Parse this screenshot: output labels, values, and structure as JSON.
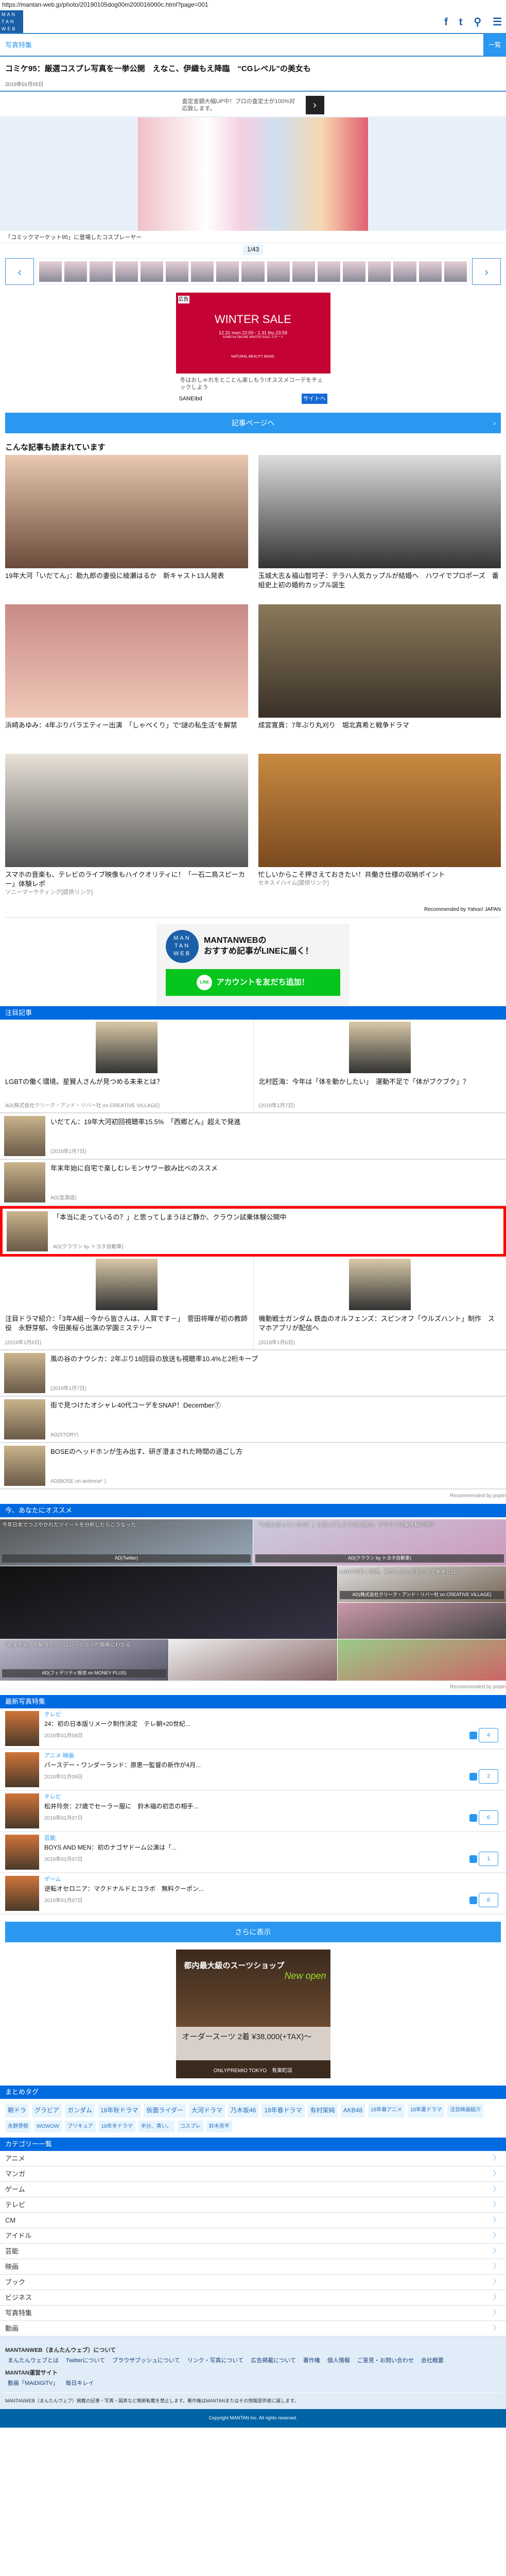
{
  "url": "https://mantan-web.jp/photo/20190105dog00m200016000c.html?page=001",
  "header": {
    "logo": "MAN TAN WEB",
    "icons": [
      "facebook-icon",
      "twitter-icon",
      "search-icon",
      "menu-icon"
    ],
    "icon_glyphs": [
      "f",
      "t",
      "⚲",
      "☰"
    ]
  },
  "section_bar": {
    "label": "写真特集",
    "button": "一覧"
  },
  "article": {
    "title": "コミケ95：厳選コスプレ写真を一挙公開　えなこ、伊織もえ降臨　“CGレベル”の美女も",
    "date": "2019年01月05日"
  },
  "top_ad": {
    "text": "査定金額大幅UP中！プロの査定士が100%対応致します。",
    "arrow": "›"
  },
  "gallery": {
    "caption": "「コミックマーケット95」に登場したコスプレーヤー",
    "counter": "1/43",
    "thumb_count": 17,
    "prev": "‹",
    "next": "›"
  },
  "ad1": {
    "badge": "広告",
    "headline": "WINTER SALE",
    "sub": "12.31 mon 22:00 - 1.31 thu 23:59",
    "sub2": "SANEI bd ONLINE WINTER SALE スタート",
    "brand": "NATURAL BEAUTY BASIC",
    "desc": "冬はおしゃれをとことん楽しもう!オススメコーデをチェックしよう",
    "advertiser": "SANEIbd",
    "cta": "サイトへ"
  },
  "article_button": {
    "label": "記事ページへ",
    "chevron": "›"
  },
  "popular": {
    "heading": "こんな記事も読まれています",
    "items": [
      {
        "title": "19年大河「いだてん」：勘九郎の妻役に綾瀬はるか　新キャスト13人発表",
        "source": ""
      },
      {
        "title": "玉城大志＆福山智可子：テラハ人気カップルが結婚へ　ハワイでプロポーズ　番組史上初の婚約カップル誕生",
        "source": ""
      },
      {
        "title": "浜崎あゆみ：4年ぶりバラエティー出演　「しゃべくり」で“謎の私生活”を解禁",
        "source": ""
      },
      {
        "title": "成宮寛貴：7年ぶり丸刈り　堀北真希と戦争ドラマ",
        "source": ""
      },
      {
        "title": "スマホの音楽も、テレビのライブ映像もハイクオリティに！「一石二鳥スピーカー」体験レポ",
        "source": "ソニーマーケティング[提供リンク]"
      },
      {
        "title": "忙しいからこそ押さえておきたい！共働き仕様の収納ポイント",
        "source": "セキスイハイム[提供リンク]"
      }
    ],
    "recommended": "Recommended by Yahoo! JAPAN"
  },
  "line_promo": {
    "logo": "MAN TAN WEB",
    "text1": "MANTANWEBの",
    "text2": "おすすめ記事がLINEに届く！",
    "icon": "LINE",
    "button": "アカウントを友だち追加！"
  },
  "featured": {
    "heading": "注目記事",
    "blocks": [
      {
        "type": "grid",
        "items": [
          {
            "title": "LGBTの働く環境。星賢人さんが見つめる未来とは？",
            "source": "AD(株式会社クリーク・アンド・リバー社 on CREATIVE VILLAGE)"
          },
          {
            "title": "北村匠海：今年は「体を動かしたい」　運動不足で「体がブクブク」？",
            "source": "(2019年1月7日)"
          }
        ]
      },
      {
        "type": "list",
        "items": [
          {
            "title": "いだてん：19年大河初回視聴率15.5%　「西郷どん」超えで発進",
            "source": "(2019年1月7日)"
          },
          {
            "title": "年末年始に自宅で楽しむレモンサワー飲み比べのススメ",
            "source": "AD(宝酒造)"
          },
          {
            "title": "「本当に走っているの？」と思ってしまうほど静か、クラウン試乗体験公開中",
            "source": "AD(クラウン by トヨタ自動車)",
            "highlight": true
          }
        ]
      },
      {
        "type": "grid",
        "items": [
          {
            "title": "注目ドラマ紹介：「3年A組－今から皆さんは、人質です－」　菅田将暉が初の教師役　永野芽郁、今田美桜ら出演の学園ミステリー",
            "source": "(2019年1月6日)"
          },
          {
            "title": "機動戦士ガンダム 鉄血のオルフェンズ：スピンオフ「ウルズハント」制作　スマホアプリが配信へ",
            "source": "(2019年1月6日)"
          }
        ]
      },
      {
        "type": "list",
        "items": [
          {
            "title": "風の谷のナウシカ：2年ぶり18回目の放送も視聴率10.4%と2桁キープ",
            "source": "(2019年1月7日)"
          },
          {
            "title": "街で見つけたオシャレ40代コーデをSNAP！December⑦",
            "source": "AD(STORY)"
          },
          {
            "title": "BOSEのヘッドホンが生み出す、研ぎ澄まされた時間の過ごし方",
            "source": "AD(BOSE on antenna* )"
          }
        ]
      }
    ],
    "recommended": "Recommended by popIn"
  },
  "for_you": {
    "heading": "今、あなたにオススメ",
    "tiles": [
      {
        "title": "今年日本でつぶやかれたツイートを分析したらこうなった",
        "source": "AD(Twitter)"
      },
      {
        "title": "「本当に走っているの？」と思ってしまうほど静か、クラウン試乗体験公開中",
        "source": "AD(クラウン by トヨタ自動車)"
      },
      {
        "title": "",
        "source": ""
      },
      {
        "title": "LGBTの働く環境。星賢人さんが見つめる未来とは？",
        "source": "AD(株式会社クリーク・アンド・リバー社 on CREATIVE VILLAGE)"
      },
      {
        "title": "",
        "source": ""
      },
      {
        "title": "「老後不安」を解消。シミュレーションが簡単にわかる",
        "source": "AD(フィデリティ投信 on MONEY PLUS)"
      },
      {
        "title": "",
        "source": ""
      },
      {
        "title": "",
        "source": ""
      }
    ],
    "recommended": "Recommended by popIn"
  },
  "latest_photos": {
    "heading": "最新写真特集",
    "items": [
      {
        "category": "テレビ",
        "title": "24：初の日本版リメーク制作決定　テレ朝×20世紀...",
        "date": "2019年01月08日",
        "count": "4"
      },
      {
        "category": "アニメ 映画",
        "title": "バースデー・ワンダーランド：原恵一監督の新作が4月...",
        "date": "2019年01月08日",
        "count": "2"
      },
      {
        "category": "テレビ",
        "title": "松井玲奈：27歳でセーラー服に　鈴木福の初恋の相手...",
        "date": "2019年01月07日",
        "count": "6"
      },
      {
        "category": "芸能",
        "title": "BOYS AND MEN：初のナゴヤドーム公演は「...",
        "date": "2019年01月07日",
        "count": "1"
      },
      {
        "category": "ゲーム",
        "title": "逆転オセロニア：マクドナルドとコラボ　無料クーポン...",
        "date": "2019年01月07日",
        "count": "6"
      }
    ],
    "more": "さらに表示"
  },
  "ad2": {
    "headline": "都内最大級のスーツショップ",
    "badge": "New open",
    "price": "オーダースーツ 2着 ¥38,000(+TAX)〜",
    "store": "ONLYPREMIO TOKYO　有楽町店"
  },
  "tags": {
    "heading": "まとめタグ",
    "items": [
      "朝ドラ",
      "グラビア",
      "ガンダム",
      "18年秋ドラマ",
      "仮面ライダー",
      "大河ドラマ",
      "乃木坂46",
      "18年春ドラマ",
      "有村架純",
      "AKB48",
      "18年春アニメ",
      "18年夏ドラマ",
      "注目映画紹介",
      "永野芽郁",
      "WOWOW",
      "プリキュア",
      "18年冬ドラマ",
      "半分、青い。",
      "コスプレ",
      "鈴木亮平"
    ]
  },
  "categories": {
    "heading": "カテゴリー一覧",
    "items": [
      "アニメ",
      "マンガ",
      "ゲーム",
      "テレビ",
      "CM",
      "アイドル",
      "芸能",
      "映画",
      "ブック",
      "ビジネス",
      "写真特集",
      "動画"
    ]
  },
  "footer": {
    "about_heading": "MANTANWEB（まんたんウェブ）について",
    "about_links": [
      "まんたんウェブとは",
      "Twitterについて",
      "ブラウザプッシュについて",
      "リンク・写真について",
      "広告掲載について",
      "著作権",
      "個人情報",
      "ご意見・お問い合わせ",
      "会社概要"
    ],
    "sites_heading": "MANTAN運営サイト",
    "sites_links": [
      "動画「MAiDiGiTV」",
      "毎日キレイ"
    ],
    "disclaimer": "MANTANWEB（まんたんウェブ）掲載の記事・写真・図表など無断転載を禁止します。著作権はMANTANまたはその情報提供者に属します。",
    "copyright": "Copyright MANTAN Inc. All rights reserved."
  },
  "colors": {
    "brand": "#1a5fa8",
    "section_header": "#006ae0",
    "button": "#2a98f0",
    "line_green": "#06c61e",
    "highlight": "#ff0000",
    "footer_dark": "#0063a5"
  }
}
